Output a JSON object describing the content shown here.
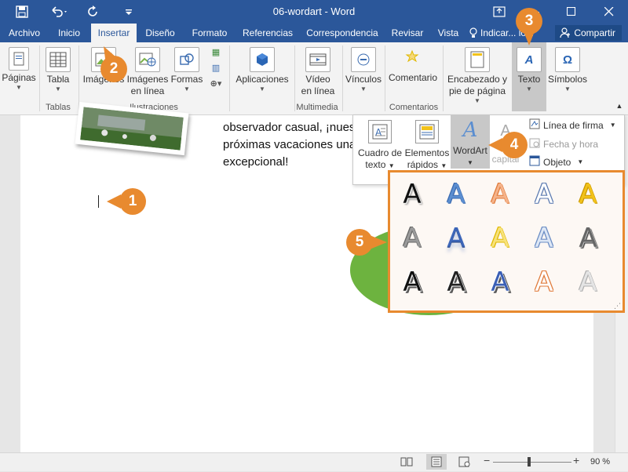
{
  "window": {
    "title": "06-wordart - Word"
  },
  "tabs": [
    "Archivo",
    "Inicio",
    "Insertar",
    "Diseño",
    "Formato",
    "Referencias",
    "Correspondencia",
    "Revisar",
    "Vista",
    "Indicar... lo..."
  ],
  "active_tab": "Insertar",
  "share_label": "Compartir",
  "ribbon": {
    "paginas": "Páginas",
    "tabla": "Tabla",
    "imagenes": "Imágenes",
    "imagenes_linea_1": "Imágenes",
    "imagenes_linea_2": "en línea",
    "formas": "Formas",
    "aplicaciones": "Aplicaciones",
    "video_1": "Vídeo",
    "video_2": "en línea",
    "vinculos": "Vínculos",
    "comentario": "Comentario",
    "encabezado_1": "Encabezado y",
    "encabezado_2": "pie de página",
    "texto": "Texto",
    "simbolos": "Símbolos",
    "groups": {
      "tablas": "Tablas",
      "ilustraciones": "Ilustraciones",
      "multimedia": "Multimedia",
      "comentarios": "Comentarios"
    }
  },
  "document": {
    "line1": "observador casual, ¡nues",
    "line2": "próximas vacaciones una",
    "line3": "excepcional!"
  },
  "text_dropdown": {
    "cuadro_1": "Cuadro de",
    "cuadro_2": "texto",
    "elementos_1": "Elementos",
    "elementos_2": "rápidos",
    "wordart": "WordArt",
    "capital": "capital",
    "linea_firma": "Línea de firma",
    "fecha_hora": "Fecha y hora",
    "objeto": "Objeto"
  },
  "wordart_gallery": {
    "glyph": "A",
    "rows": [
      [
        {
          "fill": "#111111",
          "stroke": "#ffffff",
          "style": "plain-shadow"
        },
        {
          "fill": "#5b8ed0",
          "stroke": "#3a6ab0",
          "style": "gradient"
        },
        {
          "fill": "#f5b38a",
          "stroke": "#e07a3a",
          "style": "gradient"
        },
        {
          "fill": "#ffffff",
          "stroke": "#5b7ab0",
          "style": "outline"
        },
        {
          "fill": "#f2c21a",
          "stroke": "#c99700",
          "style": "gradient"
        }
      ],
      [
        {
          "fill": "#9a9a9a",
          "stroke": "#666666",
          "style": "gradient"
        },
        {
          "fill": "#3d66b8",
          "stroke": "#1f3f80",
          "style": "reflect"
        },
        {
          "fill": "#f7e27a",
          "stroke": "#e0b800",
          "style": "gradient"
        },
        {
          "fill": "#dde7f5",
          "stroke": "#6a8cc4",
          "style": "outline"
        },
        {
          "fill": "#666666",
          "stroke": "#333333",
          "style": "bevel"
        }
      ],
      [
        {
          "fill": "#111111",
          "stroke": "#ffffff",
          "style": "shadow"
        },
        {
          "fill": "#222222",
          "stroke": "#ffffff",
          "style": "shadow"
        },
        {
          "fill": "#3b5fb5",
          "stroke": "#ffffff",
          "style": "shadow"
        },
        {
          "fill": "#ffffff",
          "stroke": "#e07a3a",
          "style": "outline"
        },
        {
          "fill": "#e4e4e4",
          "stroke": "#b0b0b0",
          "style": "gradient"
        }
      ]
    ]
  },
  "callouts": [
    "1",
    "2",
    "3",
    "4",
    "5"
  ],
  "status": {
    "zoom": "90 %"
  },
  "colors": {
    "word_blue": "#2b579a",
    "callout_orange": "#e88a2f"
  }
}
